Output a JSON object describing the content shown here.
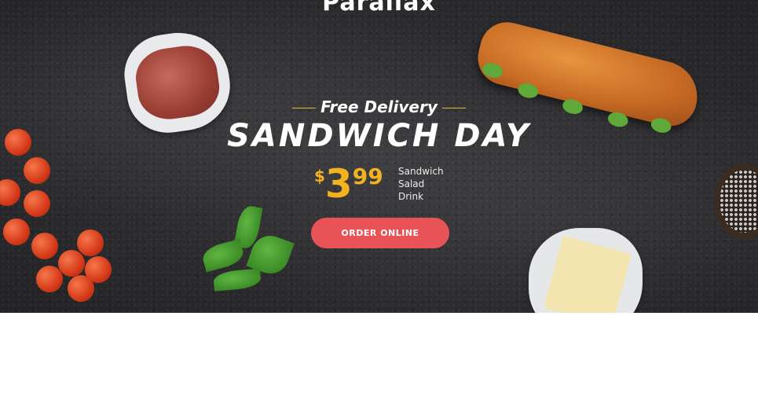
{
  "hero": {
    "top_title": "Parallax",
    "tagline": "Free Delivery",
    "headline": "SANDWICH DAY",
    "price": {
      "currency": "$",
      "integer": "3",
      "decimal": "99"
    },
    "items": [
      "Sandwich",
      "Salad",
      "Drink"
    ],
    "cta_label": "ORDER ONLINE"
  },
  "colors": {
    "accent_price": "#f3b21f",
    "cta_background": "#e85358",
    "background": "#2c2c2f"
  },
  "icons": [
    "sandwich-image",
    "ham-image",
    "cheese-image",
    "basil-image",
    "tomato-vine-image",
    "peppercorn-bowl-image"
  ]
}
